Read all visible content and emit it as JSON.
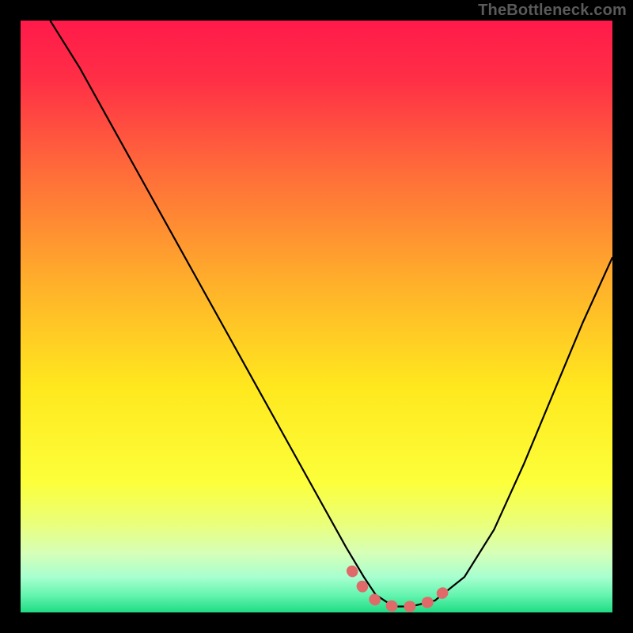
{
  "watermark": "TheBottleneck.com",
  "chart_data": {
    "type": "line",
    "title": "",
    "xlabel": "",
    "ylabel": "",
    "xlim": [
      0,
      100
    ],
    "ylim": [
      0,
      100
    ],
    "curve": {
      "x": [
        5,
        10,
        15,
        20,
        25,
        30,
        35,
        40,
        45,
        50,
        55,
        58,
        60,
        63,
        66,
        70,
        75,
        80,
        85,
        90,
        95,
        100
      ],
      "y": [
        100,
        92,
        83,
        74,
        65,
        56,
        47,
        38,
        29,
        20,
        11,
        6,
        3,
        1,
        1,
        2,
        6,
        14,
        25,
        37,
        49,
        60
      ]
    },
    "highlight_segment": {
      "x": [
        56,
        58,
        60,
        63,
        66,
        70,
        72
      ],
      "y": [
        7,
        4,
        2,
        1,
        1,
        2,
        4
      ]
    },
    "gradient_stops": [
      {
        "pos": 0.0,
        "color": "#ff1a4a"
      },
      {
        "pos": 0.1,
        "color": "#ff2f46"
      },
      {
        "pos": 0.25,
        "color": "#ff6a3a"
      },
      {
        "pos": 0.45,
        "color": "#ffb22a"
      },
      {
        "pos": 0.62,
        "color": "#ffe81e"
      },
      {
        "pos": 0.78,
        "color": "#fcff3a"
      },
      {
        "pos": 0.85,
        "color": "#eaff7a"
      },
      {
        "pos": 0.9,
        "color": "#d6ffb8"
      },
      {
        "pos": 0.94,
        "color": "#a8ffcf"
      },
      {
        "pos": 0.97,
        "color": "#66f5b0"
      },
      {
        "pos": 1.0,
        "color": "#1fdc84"
      }
    ]
  }
}
